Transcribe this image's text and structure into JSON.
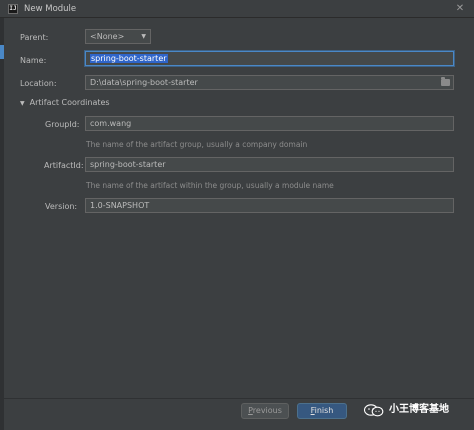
{
  "window": {
    "title": "New Module",
    "app_icon_text": "IJ"
  },
  "form": {
    "parent": {
      "label": "Parent:",
      "value": "<None>"
    },
    "name": {
      "label": "Name:",
      "value": "spring-boot-starter"
    },
    "location": {
      "label": "Location:",
      "value": "D:\\data\\spring-boot-starter"
    }
  },
  "artifact": {
    "section_label": "Artifact Coordinates",
    "group_id": {
      "label": "GroupId:",
      "value": "com.wang",
      "hint": "The name of the artifact group, usually a company domain"
    },
    "artifact_id": {
      "label": "ArtifactId:",
      "value": "spring-boot-starter",
      "hint": "The name of the artifact within the group, usually a module name"
    },
    "version": {
      "label": "Version:",
      "value": "1.0-SNAPSHOT"
    }
  },
  "buttons": {
    "previous_prefix": "",
    "previous_mnemonic": "P",
    "previous_rest": "revious",
    "finish_mnemonic": "F",
    "finish_rest": "inish"
  },
  "watermark": {
    "text": "小王博客基地",
    "icon": "wechat-icon"
  },
  "colors": {
    "background": "#3c3f41",
    "field": "#45494a",
    "accent": "#4a88c7",
    "finish_button": "#365880",
    "selection": "#2f65ca"
  }
}
